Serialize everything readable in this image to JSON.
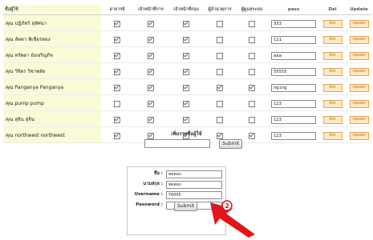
{
  "table": {
    "headers": [
      "ชื่อผู้ใช้",
      "อาจารย์",
      "เจ้าหน้าที่การ",
      "เจ้าหน้าที่กอง",
      "ผู้อำนวยการ",
      "ผู้ดูแลระบบ",
      "pass",
      "Del",
      "Update"
    ],
    "rows": [
      {
        "name": "คุณ ปฎิภัทร์ สุทัศนา",
        "perms": [
          true,
          true,
          true,
          false,
          false
        ],
        "password": "333",
        "del": "Del",
        "update": "Update"
      },
      {
        "name": "คุณ ลัดดา พิเชียรทอง",
        "perms": [
          true,
          true,
          true,
          false,
          false
        ],
        "password": "111",
        "del": "Del",
        "update": "Update"
      },
      {
        "name": "คุณ ทรัพยา ยังเจริญกิจ",
        "perms": [
          true,
          true,
          true,
          false,
          false
        ],
        "password": "aaa",
        "del": "Del",
        "update": "Update"
      },
      {
        "name": "คุณ วิจิตร วิชาพลัย",
        "perms": [
          true,
          true,
          true,
          false,
          false
        ],
        "password": "55555",
        "del": "Del",
        "update": "Update"
      },
      {
        "name": "คุณ Panganya Panganya",
        "perms": [
          true,
          true,
          true,
          true,
          true
        ],
        "password": "nging",
        "del": "Del",
        "update": "Update"
      },
      {
        "name": "คุณ pump pump",
        "perms": [
          false,
          true,
          true,
          false,
          false
        ],
        "password": "123",
        "del": "Del",
        "update": "Update"
      },
      {
        "name": "คุณ สุจิน สุจิน",
        "perms": [
          true,
          true,
          true,
          false,
          false
        ],
        "password": "123",
        "del": "Del",
        "update": "Update"
      },
      {
        "name": "คุณ northwest northwest",
        "perms": [
          true,
          true,
          true,
          true,
          true
        ],
        "password": "123",
        "del": "Del",
        "update": "Update"
      }
    ]
  },
  "add_user": {
    "title": "เพิ่มรายชื่อผู้ใช้",
    "submit": "Submit"
  },
  "login_form": {
    "name_label": "ชื่อ :",
    "name_value": "ทดสอบ",
    "surname_label": "นามสกุล :",
    "surname_value": "ทดสอบ",
    "username_label": "Username :",
    "username_value": "Y0005",
    "password_label": "Password :",
    "password_value": "",
    "submit": "Submit"
  },
  "pointer": {
    "step": "2",
    "color": "#e0161b"
  },
  "colors": {
    "name_bg": "#fafad6",
    "button_bg": "#ffe9c4",
    "button_text": "#b4641b"
  }
}
